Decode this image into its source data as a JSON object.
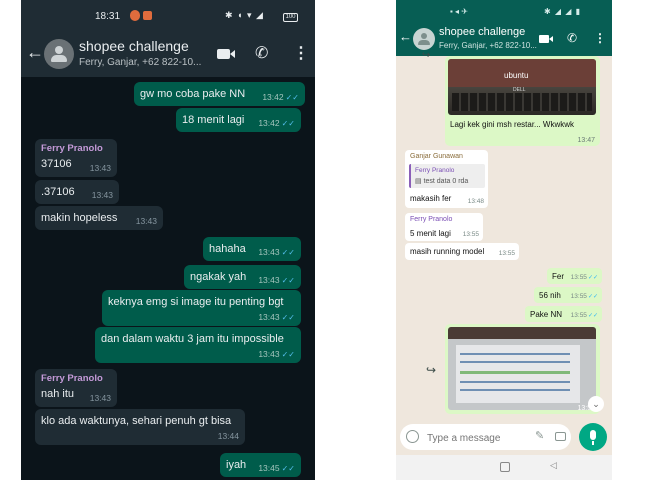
{
  "phone1": {
    "status": {
      "time": "18:31",
      "battery": "100"
    },
    "header": {
      "title": "shopee challenge",
      "subtitle": "Ferry, Ganjar, +62 822-10..."
    },
    "messages": [
      {
        "text": "gw mo coba pake NN",
        "time": "13:42",
        "out": true
      },
      {
        "text": "18 menit lagi",
        "time": "13:42",
        "out": true
      },
      {
        "sender": "Ferry Pranolo",
        "text": "37106",
        "time": "13:43"
      },
      {
        "text": ".37106",
        "time": "13:43"
      },
      {
        "text": "makin hopeless",
        "time": "13:43"
      },
      {
        "text": "hahaha",
        "time": "13:43",
        "out": true
      },
      {
        "text": "ngakak yah",
        "time": "13:43",
        "out": true
      },
      {
        "text": "keknya emg si image itu penting bgt",
        "time": "13:43",
        "out": true
      },
      {
        "text": "dan dalam waktu 3 jam itu impossible",
        "time": "13:43",
        "out": true
      },
      {
        "sender": "Ferry Pranolo",
        "text": "nah itu",
        "time": "13:43"
      },
      {
        "text": "klo ada waktunya, sehari penuh gt bisa",
        "time": "13:44"
      },
      {
        "text": "iyah",
        "time": "13:45",
        "out": true
      }
    ]
  },
  "phone2": {
    "header": {
      "title": "shopee challenge",
      "subtitle": "Ferry, Ganjar, +62 822-10..."
    },
    "image1": {
      "ubuntu": "ubuntu",
      "brand": "DELL",
      "caption": "Lagi kek gini msh restar... Wkwkwk",
      "time": "13:47"
    },
    "quoted": {
      "sender": "Ganjar Gunawan",
      "quote_sender": "Ferry Pranolo",
      "quote_text": "test data 0 rda",
      "text": "makasih fer",
      "time": "13:48"
    },
    "m_in1": {
      "sender": "Ferry Pranolo",
      "text": "5 menit lagi",
      "time": "13:55"
    },
    "m_in2": {
      "text": "masih running model",
      "time": "13:55"
    },
    "out_msgs": [
      {
        "text": "Fer",
        "time": "13:55"
      },
      {
        "text": "56 nih",
        "time": "13:55"
      },
      {
        "text": "Pake NN",
        "time": "13:55"
      }
    ],
    "image2": {
      "time": "13:55"
    },
    "composer": {
      "placeholder": "Type a message"
    }
  },
  "icons": [
    "back-arrow-icon",
    "group-avatar-icon",
    "video-call-icon",
    "phone-call-icon",
    "more-menu-icon",
    "double-check-icon",
    "forward-icon",
    "scroll-down-icon",
    "emoji-icon",
    "attach-icon",
    "camera-icon",
    "mic-icon"
  ],
  "colors": {
    "dark_bg": "#0b141a",
    "dark_out_bubble": "#005c4b",
    "dark_in_bubble": "#1f2c34",
    "light_header": "#075e54",
    "light_out_bubble": "#dcf8c6",
    "accent": "#00a884"
  }
}
